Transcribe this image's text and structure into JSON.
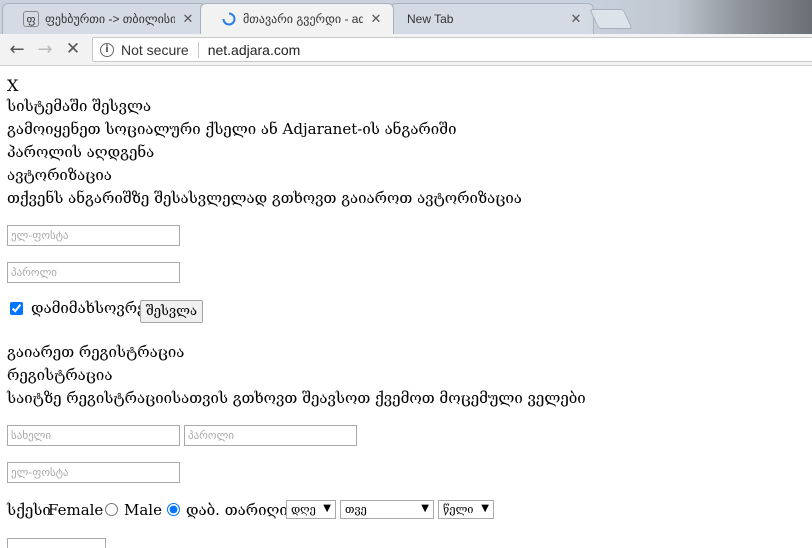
{
  "browser": {
    "tabs": [
      {
        "favicon": "ფ",
        "title": "ფეხბურთი -> თბილისის",
        "close": "✕"
      },
      {
        "favicon": "loading-spinner",
        "title": "მთავარი გვერდი - adjara",
        "close": "✕"
      },
      {
        "favicon": "",
        "title": "New Tab",
        "close": "✕"
      }
    ],
    "security_label": "Not secure",
    "url": "net.adjara.com"
  },
  "login": {
    "close_text": "X",
    "title": "სისტემაში შესვლა",
    "social_text": "გამოიყენეთ სოციალური ქსელი ან Adjaranet-ის ანგარიში",
    "recover_text": "პაროლის აღდგენა",
    "auth_title": "ავტორიზაცია",
    "auth_desc": "თქვენს ანგარიშზე შესასვლელად გთხოვთ გაიაროთ ავტორიზაცია",
    "email_placeholder": "ელ-ფოსტა",
    "password_placeholder": "პაროლი",
    "remember_label": "დამიმახსოვრე",
    "remember_checked": true,
    "submit_label": "შესვლა"
  },
  "register": {
    "heading1": "გაიარეთ რეგისტრაცია",
    "heading2": "რეგისტრაცია",
    "desc": "საიტზე რეგისტრაციისათვის გთხოვთ შეავსოთ ქვემოთ მოცემული ველები",
    "name_placeholder": "სახელი",
    "password_placeholder": "პაროლი",
    "email_placeholder": "ელ-ფოსტა",
    "gender_label": "სქესი",
    "female_label": "Female",
    "male_label": "Male",
    "selected_gender": "Male",
    "dob_label": "დაბ. თარიღი",
    "day_value": "დღე",
    "month_value": "თვე",
    "year_value": "წელი"
  }
}
